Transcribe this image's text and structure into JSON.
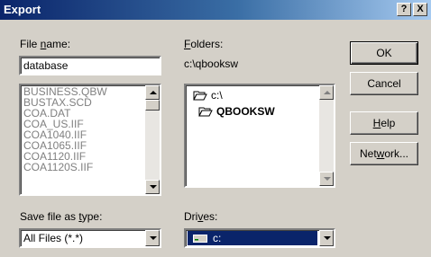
{
  "window": {
    "title": "Export",
    "help_btn": "?",
    "close_btn": "X"
  },
  "file_name": {
    "label_pre": "File ",
    "label_key": "n",
    "label_post": "ame:",
    "value": "database"
  },
  "file_list": [
    "BUSINESS.QBW",
    "BUSTAX.SCD",
    "COA.DAT",
    "COA_US.IIF",
    "COA1040.IIF",
    "COA1065.IIF",
    "COA1120.IIF",
    "COA1120S.IIF"
  ],
  "folders": {
    "label_key": "F",
    "label_post": "olders:",
    "path": "c:\\qbooksw",
    "tree": [
      "c:\\",
      "QBOOKSW"
    ]
  },
  "save_type": {
    "label_pre": "Save file as ",
    "label_key": "t",
    "label_post": "ype:",
    "value": "All Files (*.*)"
  },
  "drives": {
    "label_pre": "Dri",
    "label_key": "v",
    "label_post": "es:",
    "value": "c:"
  },
  "buttons": {
    "ok": "OK",
    "cancel": "Cancel",
    "help_key": "H",
    "help_post": "elp",
    "network_pre": "Net",
    "network_key": "w",
    "network_post": "ork..."
  }
}
